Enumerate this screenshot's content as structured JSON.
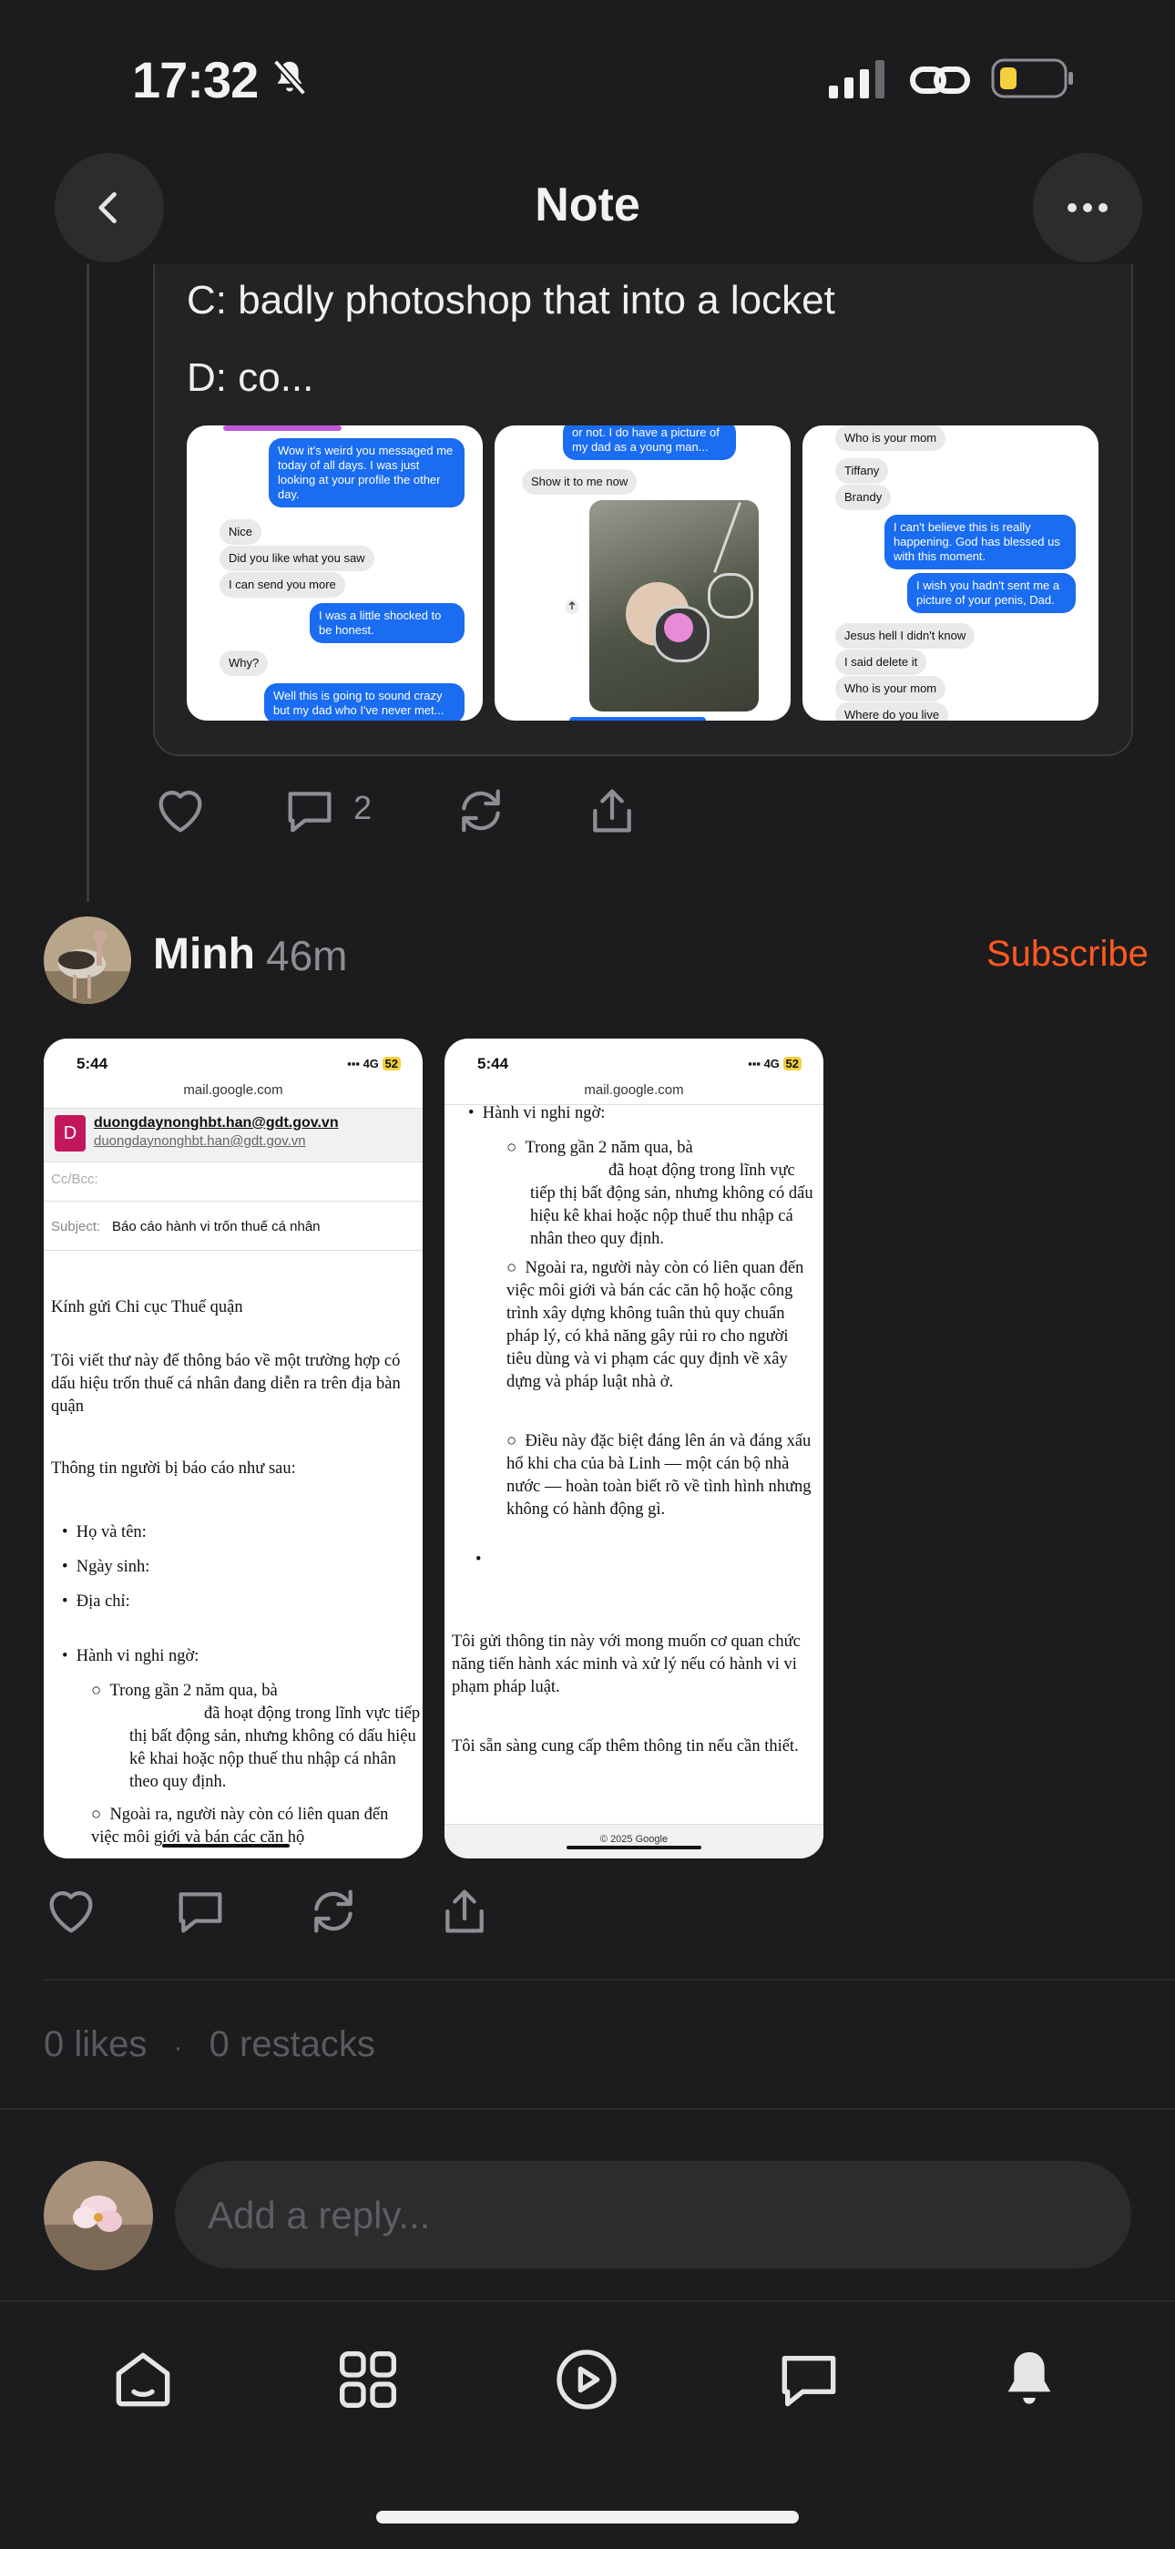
{
  "status_bar": {
    "time": "17:32"
  },
  "header": {
    "title": "Note"
  },
  "quoted_note": {
    "lines": [
      "C: badly photoshop that into a locket",
      "D: co..."
    ],
    "screenshot1": {
      "b1": "Wow it's weird you messaged me today of all days. I was just looking at your profile the other day.",
      "b2": "Nice",
      "b3": "Did you like what you saw",
      "b4": "I can send you more",
      "b5": "I was a little shocked to be honest.",
      "b6": "Why?",
      "b7": "Well this is going to sound crazy but my dad who I've never met..."
    },
    "screenshot2": {
      "b1": "or not. I do have a picture of my dad as a young man...",
      "b2": "Show it to me now"
    },
    "screenshot3": {
      "b1": "Who is your mom",
      "b2": "Tiffany",
      "b3": "Brandy",
      "b4": "I can't believe this is really happening. God has blessed us with this moment.",
      "b5": "I wish you hadn't sent me a picture of your penis, Dad.",
      "b6": "Jesus hell I didn't know",
      "b7": "I said delete it",
      "b8": "Who is your mom",
      "b9": "Where do you live"
    },
    "actions": {
      "comments": "2"
    }
  },
  "post": {
    "author": "Minh",
    "time_ago": "46m",
    "subscribe_label": "Subscribe",
    "email_left": {
      "time": "5:44",
      "network": "4G",
      "battery": "52",
      "url": "mail.google.com",
      "sender_initial": "D",
      "sender": "duongdaynonghbt.han@gdt.gov.vn",
      "sender_sub": "duongdaynonghbt.han@gdt.gov.vn",
      "cc_label": "Cc/Bcc:",
      "subject_label": "Subject:",
      "subject": "Báo cáo hành vi trốn thuế cá nhân",
      "greeting": "Kính gửi Chi cục Thuế quận",
      "p1": "Tôi viết thư này để thông báo về một trường hợp có dấu hiệu trốn thuế cá nhân đang diễn ra trên địa bàn quận",
      "p2": "Thông tin người bị báo cáo như sau:",
      "li1": "Họ và tên:",
      "li2": "Ngày sinh:",
      "li3": "Địa chỉ:",
      "li4": "Hành vi nghi ngờ:",
      "sub1": "Trong gần 2 năm qua, bà",
      "sub1b": "đã hoạt động trong lĩnh vực tiếp thị bất động sản, nhưng không có dấu hiệu kê khai hoặc nộp thuế thu nhập cá nhân theo quy định.",
      "sub2": "Ngoài ra, người này còn có liên quan đến việc môi giới và bán các căn hộ"
    },
    "email_right": {
      "time": "5:44",
      "network": "4G",
      "battery": "52",
      "url": "mail.google.com",
      "li": "Hành vi nghi ngờ:",
      "sub1": "Trong gần 2 năm qua, bà",
      "sub1b": "đã hoạt động trong lĩnh vực tiếp thị bất động sản, nhưng không có dấu hiệu kê khai hoặc nộp thuế thu nhập cá nhân theo quy định.",
      "sub2": "Ngoài ra, người này còn có liên quan đến việc môi giới và bán các căn hộ hoặc công trình xây dựng không tuân thủ quy chuẩn pháp lý, có khả năng gây rủi ro cho người tiêu dùng và vi phạm các quy định về xây dựng và pháp luật nhà ở.",
      "sub3": "Điều này đặc biệt đáng lên án và đáng xấu hổ khi cha của bà Linh — một cán bộ nhà nước — hoàn toàn biết rõ về tình hình nhưng không có hành động gì.",
      "p1": "Tôi gửi thông tin này với mong muốn cơ quan chức năng tiến hành xác minh và xử lý nếu có hành vi vi phạm pháp luật.",
      "p2": "Tôi sẵn sàng cung cấp thêm thông tin nếu cần thiết.",
      "footer": "© 2025 Google"
    },
    "stats": {
      "likes": "0 likes",
      "separator": "·",
      "restacks": "0 restacks"
    }
  },
  "reply": {
    "placeholder": "Add a reply..."
  },
  "tabbar": {
    "icons": [
      "home-icon",
      "grid-icon",
      "play-icon",
      "chat-icon",
      "bell-icon"
    ]
  },
  "colors": {
    "accent": "#ff5a1f",
    "background": "#1c1c1e",
    "surface": "#2c2c2e"
  }
}
